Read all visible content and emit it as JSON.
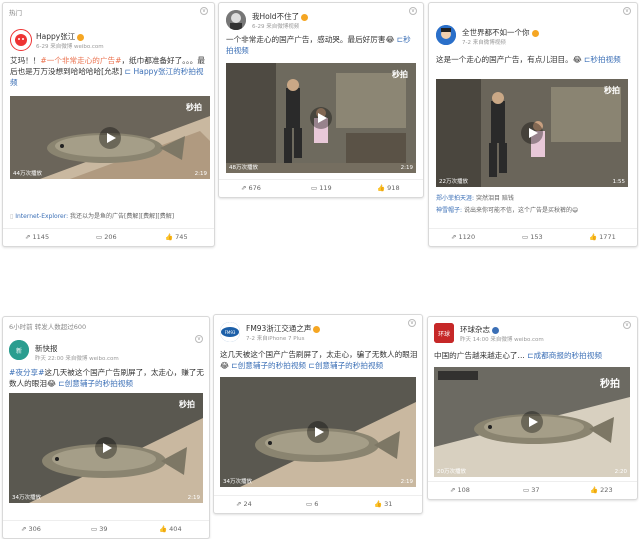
{
  "cards": [
    {
      "tag": "热门",
      "user": "Happy张江",
      "meta": "6-29 来自微博 weibo.com",
      "text_a": "艾玛！！",
      "text_link": "#一个非常走心的广告#",
      "text_b": "，纸巾都准备好了。。。最后也是万万没想到哈哈哈哈[允悲]",
      "text_video": "Happy张江的秒拍视频",
      "views": "44万次播放",
      "duration": "2:19",
      "miaopai": "秒拍",
      "comment_user": "Internet-Explorer:",
      "comment_text": "我还以为是鱼的广告[费解][费解][费解]",
      "actions": [
        "1145",
        "206",
        "745"
      ]
    },
    {
      "user": "我Hold不住了",
      "meta": "6-29 来自微博视频",
      "text": "一个非常走心的国产广告，感动哭。最后好厉害",
      "text_video": "秒拍视频",
      "views": "48万次播放",
      "duration": "2:19",
      "miaopai": "秒拍",
      "actions": [
        "676",
        "119",
        "918"
      ]
    },
    {
      "user": "全世界都不如一个你",
      "meta": "7-2 来自微博视频",
      "text": "这是一个走心的国产广告，有点儿泪目。",
      "text_video": "秒拍视频",
      "views": "22万次播放",
      "duration": "1:55",
      "miaopai": "秒拍",
      "comment1_user": "郑小菲拍天涯:",
      "comment1_text": "突然泪目 赔钱",
      "comment2_user": "神雪帽子:",
      "comment2_text": "说出来你可能不信，这个广告是买秋裤的",
      "actions": [
        "1120",
        "153",
        "1771"
      ]
    },
    {
      "header": "6小时前 转发人数超过600",
      "user": "新快报",
      "meta": "昨天 22:00 来自微博 weibo.com",
      "text_link": "#夜分享#",
      "text": "这几天被这个国产广告刷屏了，太走心，赚了无数人的眼泪",
      "text_video": "创意辅子的秒拍视频",
      "views": "34万次播放",
      "duration": "2:19",
      "miaopai": "秒拍",
      "actions": [
        "306",
        "39",
        "404"
      ]
    },
    {
      "user": "FM93浙江交通之声",
      "meta": "7-2 来自iPhone 7 Plus",
      "text": "这几天被这个国产广告刷屏了，太走心，骗了无数人的眼泪",
      "text_video1": "创意辅子的秒拍视频",
      "text_video2": "创意辅子的秒拍视频",
      "views": "34万次播放",
      "duration": "2:19",
      "actions": [
        "24",
        "6",
        "31"
      ]
    },
    {
      "user": "环球杂志",
      "meta": "昨天 14:00 来自微博 weibo.com",
      "text": "中国的广告越来越走心了...",
      "text_video": "成都商报的秒拍视频",
      "overlay": "秒拍",
      "views": "20万次播放",
      "duration": "2:20",
      "actions": [
        "108",
        "37",
        "223"
      ]
    }
  ]
}
